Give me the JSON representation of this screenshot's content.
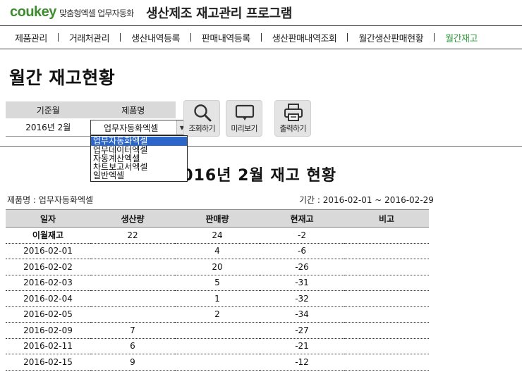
{
  "brand": {
    "logo": "coukey",
    "subtitle": "맞춤형엑셀 업무자동화"
  },
  "app_title": "생산제조 재고관리 프로그램",
  "menu": [
    {
      "label": "제품관리",
      "active": false
    },
    {
      "label": "거래처관리",
      "active": false
    },
    {
      "label": "생산내역등록",
      "active": false
    },
    {
      "label": "판매내역등록",
      "active": false
    },
    {
      "label": "생산판매내역조회",
      "active": false
    },
    {
      "label": "월간생산판매현황",
      "active": false
    },
    {
      "label": "월간재고",
      "active": true
    }
  ],
  "page_heading": "월간 재고현황",
  "criteria": {
    "base_month_header": "기준월",
    "product_header": "제품명",
    "base_month_value": "2016년 2월",
    "product_value": "업무자동화엑셀",
    "product_options": [
      "업무자동화엑셀",
      "업무데이터엑셀",
      "자동계산엑셀",
      "차트보고서엑셀",
      "일반엑셀"
    ],
    "selected_option": "업무자동화엑셀"
  },
  "buttons": {
    "search": "조회하기",
    "preview": "미리보기",
    "print": "출력하기"
  },
  "report": {
    "title": "2016년 2월 재고 현황",
    "product_caption": "제품명 : 업무자동화엑셀",
    "period_caption": "기간 : 2016-02-01 ~ 2016-02-29",
    "columns": [
      "일자",
      "생산량",
      "판매량",
      "현재고",
      "비고"
    ],
    "rows": [
      [
        "이월재고",
        "22",
        "24",
        "-2",
        ""
      ],
      [
        "2016-02-01",
        "",
        "4",
        "-6",
        ""
      ],
      [
        "2016-02-02",
        "",
        "20",
        "-26",
        ""
      ],
      [
        "2016-02-03",
        "",
        "5",
        "-31",
        ""
      ],
      [
        "2016-02-04",
        "",
        "1",
        "-32",
        ""
      ],
      [
        "2016-02-05",
        "",
        "2",
        "-34",
        ""
      ],
      [
        "2016-02-09",
        "7",
        "",
        "-27",
        ""
      ],
      [
        "2016-02-11",
        "6",
        "",
        "-21",
        ""
      ],
      [
        "2016-02-15",
        "9",
        "",
        "-12",
        ""
      ]
    ]
  },
  "icons": {
    "search": "magnifier-icon",
    "preview": "monitor-icon",
    "print": "printer-icon",
    "dropdown": "triangle-down-icon"
  },
  "colors": {
    "brand_green": "#3d8c2e",
    "active_menu": "#2f9a3c",
    "header_gray": "#d9d9d9",
    "selection_blue": "#2c66c9"
  }
}
